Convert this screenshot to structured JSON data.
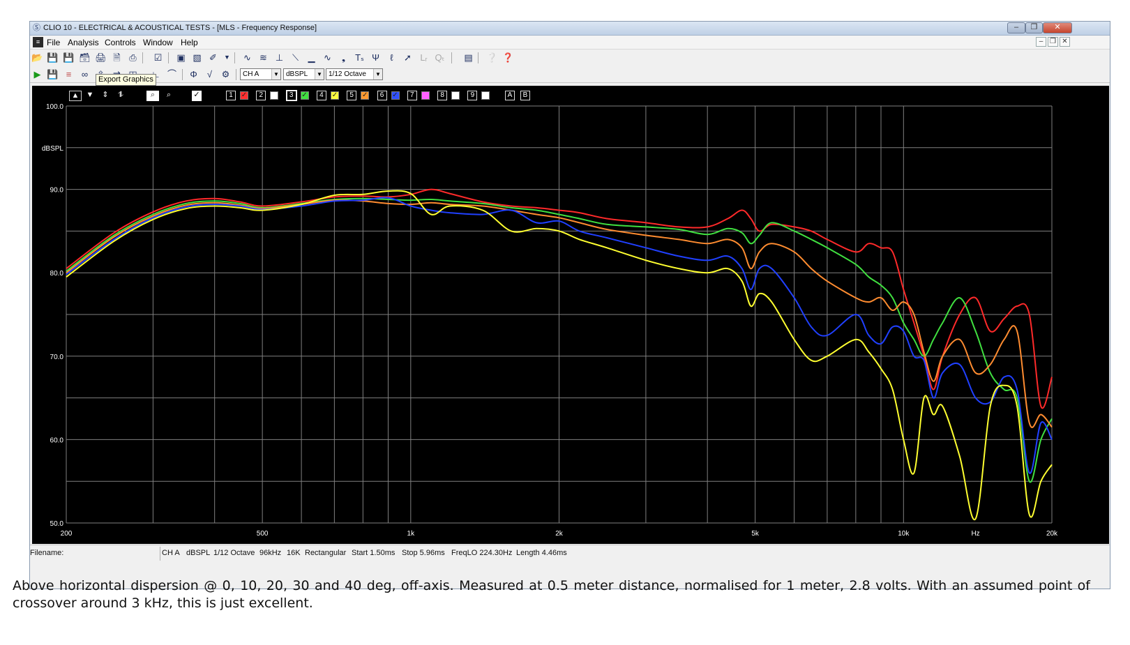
{
  "window": {
    "app_icon": "clio-icon",
    "title": "CLIO 10 - ELECTRICAL & ACOUSTICAL TESTS - [MLS - Frequency Response]"
  },
  "menu": {
    "items": [
      "File",
      "Analysis",
      "Controls",
      "Window",
      "Help"
    ]
  },
  "toolbar2": {
    "channel_select": "CH A",
    "unit_select": "dBSPL",
    "smoothing_select": "1/12 Octave"
  },
  "tooltip": "Export Graphics",
  "plot_toolbar": {
    "channel_buttons": [
      "1",
      "2",
      "3",
      "4",
      "5",
      "6",
      "7",
      "8",
      "9"
    ],
    "overlay_buttons": [
      "A",
      "B"
    ],
    "overlay_colors": [
      "#ff3030",
      "#ffffff",
      "#40e040",
      "#ffff40",
      "#ff9a30",
      "#3050ff",
      "#ff60ff",
      "#ffffff",
      "#ffffff"
    ],
    "overlay_checked": [
      true,
      false,
      true,
      true,
      true,
      true,
      false,
      false,
      false
    ]
  },
  "status": {
    "filename_label": "Filename:",
    "channel": "CH A",
    "unit": "dBSPL",
    "smoothing": "1/12 Octave",
    "sample_rate": "96kHz",
    "fft_size": "16K",
    "window": "Rectangular",
    "start": "Start 1.50ms",
    "stop": "Stop 5.96ms",
    "freq_lo": "FreqLO 224.30Hz",
    "length": "Length 4.46ms"
  },
  "caption": "Above horizontal dispersion @ 0, 10, 20, 30 and 40 deg, off-axis. Measured at 0.5 meter distance, normalised for 1 meter, 2.8 volts. With an assumed point of crossover around 3 kHz, this is just excellent.",
  "chart_data": {
    "type": "line",
    "title": "",
    "xlabel": "Hz",
    "ylabel": "dBSPL",
    "x_scale": "log",
    "xlim": [
      200,
      20000
    ],
    "ylim": [
      50,
      100
    ],
    "x_tick_labels": [
      {
        "value": 200,
        "label": "200"
      },
      {
        "value": 500,
        "label": "500"
      },
      {
        "value": 1000,
        "label": "1k"
      },
      {
        "value": 2000,
        "label": "2k"
      },
      {
        "value": 5000,
        "label": "5k"
      },
      {
        "value": 10000,
        "label": "10k"
      },
      {
        "value": 20000,
        "label": "20k"
      }
    ],
    "x_unit_label": {
      "value": 14000,
      "label": "Hz"
    },
    "y_tick_labels": [
      {
        "value": 100,
        "label": "100.0"
      },
      {
        "value": 90,
        "label": "90.0"
      },
      {
        "value": 80,
        "label": "80.0"
      },
      {
        "value": 70,
        "label": "70.0"
      },
      {
        "value": 60,
        "label": "60.0"
      },
      {
        "value": 50,
        "label": "50.0"
      }
    ],
    "y_unit_label": {
      "value": 95,
      "label": "dBSPL"
    },
    "grid": true,
    "background": "#000000",
    "grid_color": "#808080",
    "series": [
      {
        "color": "#ff2a2a",
        "points": [
          [
            200,
            80.5
          ],
          [
            250,
            84.8
          ],
          [
            300,
            87.3
          ],
          [
            350,
            88.6
          ],
          [
            400,
            88.9
          ],
          [
            450,
            88.5
          ],
          [
            500,
            88.0
          ],
          [
            600,
            88.5
          ],
          [
            700,
            89.1
          ],
          [
            800,
            89.2
          ],
          [
            900,
            89.1
          ],
          [
            1000,
            89.4
          ],
          [
            1100,
            90.0
          ],
          [
            1200,
            89.5
          ],
          [
            1400,
            88.5
          ],
          [
            1600,
            88.0
          ],
          [
            1800,
            87.8
          ],
          [
            2000,
            87.5
          ],
          [
            2200,
            87.2
          ],
          [
            2500,
            86.5
          ],
          [
            3000,
            86.0
          ],
          [
            3500,
            85.5
          ],
          [
            4000,
            85.5
          ],
          [
            4400,
            86.5
          ],
          [
            4700,
            87.5
          ],
          [
            4900,
            86.5
          ],
          [
            5100,
            85.0
          ],
          [
            5400,
            85.8
          ],
          [
            6000,
            85.5
          ],
          [
            6500,
            85.0
          ],
          [
            7000,
            84.0
          ],
          [
            8000,
            82.5
          ],
          [
            8500,
            83.5
          ],
          [
            9000,
            83.0
          ],
          [
            9500,
            82.5
          ],
          [
            10000,
            78.0
          ],
          [
            10500,
            74.0
          ],
          [
            11000,
            70.0
          ],
          [
            11500,
            66.0
          ],
          [
            12000,
            70.0
          ],
          [
            13000,
            75.0
          ],
          [
            14000,
            77.0
          ],
          [
            15000,
            73.0
          ],
          [
            16000,
            74.5
          ],
          [
            17000,
            76.0
          ],
          [
            18000,
            75.0
          ],
          [
            19000,
            64.0
          ],
          [
            20000,
            67.5
          ]
        ]
      },
      {
        "color": "#40e040",
        "points": [
          [
            200,
            80.2
          ],
          [
            250,
            84.5
          ],
          [
            300,
            87.0
          ],
          [
            350,
            88.3
          ],
          [
            400,
            88.6
          ],
          [
            450,
            88.3
          ],
          [
            500,
            87.8
          ],
          [
            600,
            88.3
          ],
          [
            700,
            88.8
          ],
          [
            800,
            88.9
          ],
          [
            900,
            88.8
          ],
          [
            1000,
            88.7
          ],
          [
            1100,
            88.8
          ],
          [
            1200,
            88.6
          ],
          [
            1400,
            88.3
          ],
          [
            1600,
            87.8
          ],
          [
            1800,
            87.5
          ],
          [
            2000,
            87.0
          ],
          [
            2200,
            86.5
          ],
          [
            2500,
            85.8
          ],
          [
            3000,
            85.5
          ],
          [
            3500,
            85.2
          ],
          [
            4000,
            84.6
          ],
          [
            4400,
            85.3
          ],
          [
            4700,
            84.8
          ],
          [
            4900,
            83.5
          ],
          [
            5100,
            84.5
          ],
          [
            5400,
            86.0
          ],
          [
            6000,
            85.0
          ],
          [
            6500,
            84.0
          ],
          [
            7000,
            83.0
          ],
          [
            8000,
            81.0
          ],
          [
            8500,
            79.5
          ],
          [
            9000,
            78.5
          ],
          [
            9500,
            77.0
          ],
          [
            10000,
            74.0
          ],
          [
            10500,
            72.0
          ],
          [
            11000,
            70.0
          ],
          [
            11500,
            72.0
          ],
          [
            12000,
            74.0
          ],
          [
            13000,
            77.0
          ],
          [
            14000,
            73.0
          ],
          [
            15000,
            68.0
          ],
          [
            16000,
            66.0
          ],
          [
            17000,
            65.0
          ],
          [
            18000,
            55.0
          ],
          [
            19000,
            60.0
          ],
          [
            20000,
            62.5
          ]
        ]
      },
      {
        "color": "#ff8c30",
        "points": [
          [
            200,
            80.0
          ],
          [
            250,
            84.3
          ],
          [
            300,
            86.8
          ],
          [
            350,
            88.1
          ],
          [
            400,
            88.4
          ],
          [
            450,
            88.1
          ],
          [
            500,
            87.7
          ],
          [
            600,
            88.2
          ],
          [
            700,
            88.7
          ],
          [
            800,
            88.6
          ],
          [
            900,
            88.3
          ],
          [
            1000,
            88.2
          ],
          [
            1100,
            88.4
          ],
          [
            1200,
            88.2
          ],
          [
            1400,
            88.0
          ],
          [
            1600,
            87.5
          ],
          [
            1800,
            87.0
          ],
          [
            2000,
            86.6
          ],
          [
            2200,
            86.0
          ],
          [
            2500,
            85.2
          ],
          [
            3000,
            84.5
          ],
          [
            3500,
            84.0
          ],
          [
            4000,
            83.5
          ],
          [
            4400,
            84.0
          ],
          [
            4700,
            83.0
          ],
          [
            4900,
            80.5
          ],
          [
            5100,
            82.5
          ],
          [
            5400,
            83.5
          ],
          [
            6000,
            82.5
          ],
          [
            6500,
            80.5
          ],
          [
            7000,
            79.0
          ],
          [
            8000,
            77.0
          ],
          [
            8500,
            76.5
          ],
          [
            9000,
            77.0
          ],
          [
            9500,
            75.5
          ],
          [
            10000,
            76.5
          ],
          [
            10500,
            75.0
          ],
          [
            11000,
            70.5
          ],
          [
            11500,
            67.0
          ],
          [
            12000,
            70.0
          ],
          [
            13000,
            72.0
          ],
          [
            14000,
            68.0
          ],
          [
            15000,
            69.0
          ],
          [
            16000,
            72.0
          ],
          [
            17000,
            73.0
          ],
          [
            18000,
            62.0
          ],
          [
            19000,
            63.0
          ],
          [
            20000,
            61.5
          ]
        ]
      },
      {
        "color": "#2040ff",
        "points": [
          [
            200,
            79.8
          ],
          [
            250,
            84.0
          ],
          [
            300,
            86.6
          ],
          [
            350,
            87.9
          ],
          [
            400,
            88.2
          ],
          [
            450,
            88.0
          ],
          [
            500,
            87.6
          ],
          [
            600,
            88.0
          ],
          [
            700,
            88.6
          ],
          [
            800,
            88.7
          ],
          [
            900,
            89.0
          ],
          [
            1000,
            88.0
          ],
          [
            1100,
            87.5
          ],
          [
            1200,
            87.2
          ],
          [
            1400,
            87.0
          ],
          [
            1600,
            87.5
          ],
          [
            1800,
            86.0
          ],
          [
            2000,
            86.2
          ],
          [
            2200,
            85.0
          ],
          [
            2500,
            84.2
          ],
          [
            3000,
            83.0
          ],
          [
            3500,
            82.0
          ],
          [
            4000,
            81.5
          ],
          [
            4400,
            82.0
          ],
          [
            4700,
            80.5
          ],
          [
            4900,
            78.0
          ],
          [
            5100,
            80.5
          ],
          [
            5400,
            80.5
          ],
          [
            6000,
            77.0
          ],
          [
            6500,
            73.5
          ],
          [
            7000,
            72.5
          ],
          [
            8000,
            75.0
          ],
          [
            8500,
            72.5
          ],
          [
            9000,
            71.5
          ],
          [
            9500,
            73.5
          ],
          [
            10000,
            73.0
          ],
          [
            10500,
            70.0
          ],
          [
            11000,
            69.5
          ],
          [
            11500,
            65.0
          ],
          [
            12000,
            68.0
          ],
          [
            13000,
            69.0
          ],
          [
            14000,
            65.0
          ],
          [
            15000,
            64.5
          ],
          [
            16000,
            67.5
          ],
          [
            17000,
            66.0
          ],
          [
            18000,
            56.0
          ],
          [
            19000,
            62.0
          ],
          [
            20000,
            60.0
          ]
        ]
      },
      {
        "color": "#ffff30",
        "points": [
          [
            200,
            79.5
          ],
          [
            250,
            83.8
          ],
          [
            300,
            86.4
          ],
          [
            350,
            87.7
          ],
          [
            400,
            88.0
          ],
          [
            450,
            87.8
          ],
          [
            500,
            87.5
          ],
          [
            600,
            88.2
          ],
          [
            700,
            89.3
          ],
          [
            800,
            89.4
          ],
          [
            900,
            89.8
          ],
          [
            1000,
            89.5
          ],
          [
            1100,
            87.0
          ],
          [
            1200,
            88.0
          ],
          [
            1400,
            87.5
          ],
          [
            1600,
            85.0
          ],
          [
            1800,
            85.3
          ],
          [
            2000,
            85.0
          ],
          [
            2200,
            84.0
          ],
          [
            2500,
            83.0
          ],
          [
            3000,
            81.5
          ],
          [
            3500,
            80.5
          ],
          [
            4000,
            80.0
          ],
          [
            4400,
            80.5
          ],
          [
            4700,
            79.0
          ],
          [
            4900,
            76.0
          ],
          [
            5100,
            77.5
          ],
          [
            5400,
            76.5
          ],
          [
            6000,
            72.0
          ],
          [
            6500,
            69.5
          ],
          [
            7000,
            70.0
          ],
          [
            8000,
            72.0
          ],
          [
            8500,
            70.5
          ],
          [
            9000,
            68.5
          ],
          [
            9500,
            66.0
          ],
          [
            10000,
            60.0
          ],
          [
            10500,
            56.0
          ],
          [
            11000,
            65.0
          ],
          [
            11500,
            63.0
          ],
          [
            12000,
            64.0
          ],
          [
            13000,
            58.0
          ],
          [
            14000,
            50.5
          ],
          [
            15000,
            64.0
          ],
          [
            16000,
            66.5
          ],
          [
            17000,
            64.0
          ],
          [
            18000,
            51.0
          ],
          [
            19000,
            55.0
          ],
          [
            20000,
            57.0
          ]
        ]
      }
    ]
  }
}
